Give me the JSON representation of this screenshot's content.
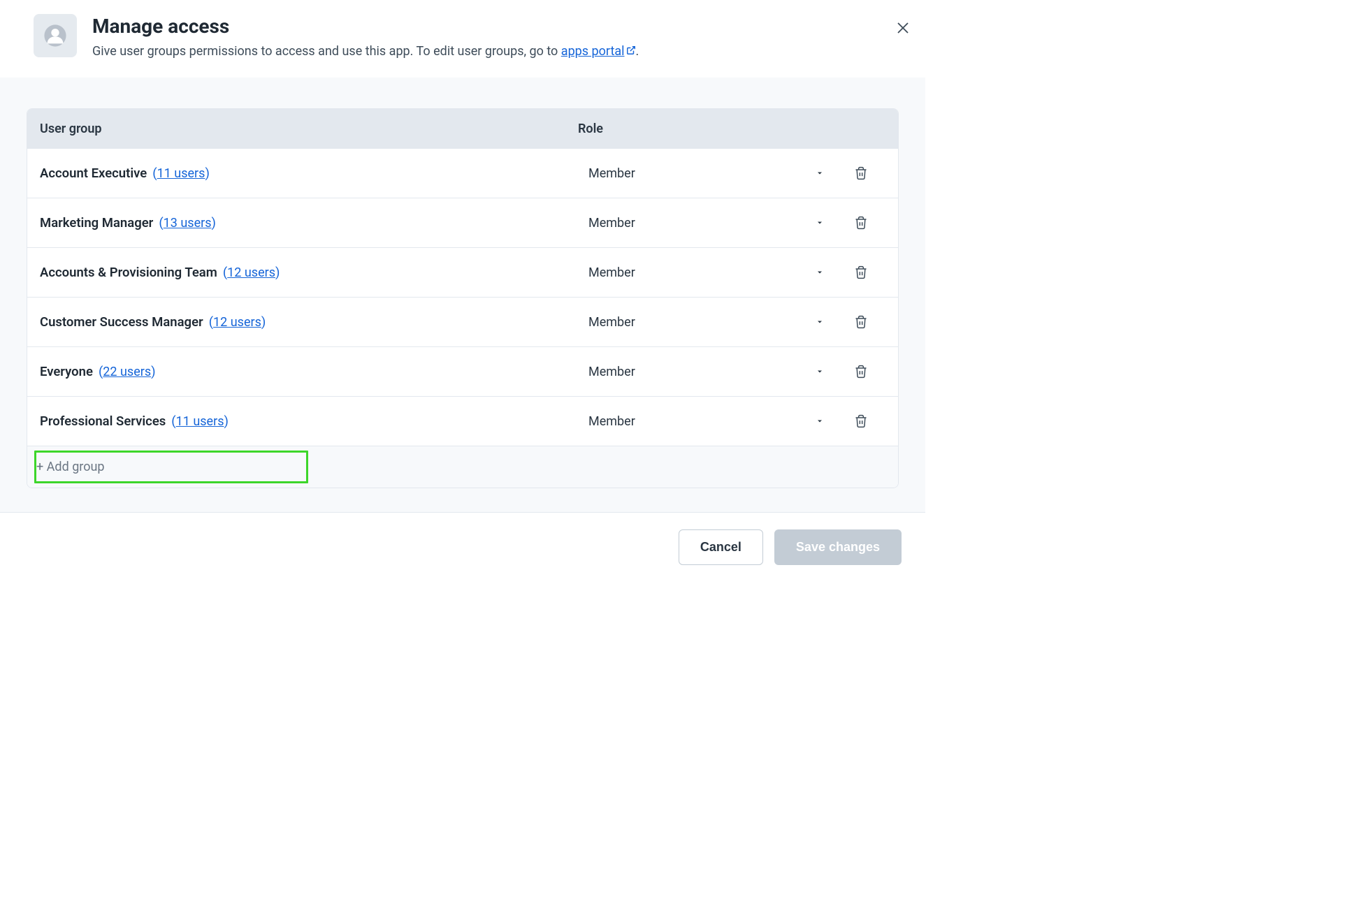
{
  "header": {
    "title": "Manage access",
    "subtitle_prefix": "Give user groups permissions to access and use this app. To edit user groups, go to ",
    "subtitle_link": "apps portal",
    "subtitle_suffix": "."
  },
  "table": {
    "col_group": "User group",
    "col_role": "Role",
    "rows": [
      {
        "name": "Account Executive",
        "users_label": "11 users",
        "role": "Member"
      },
      {
        "name": "Marketing Manager",
        "users_label": "13 users",
        "role": "Member"
      },
      {
        "name": "Accounts & Provisioning Team",
        "users_label": "12 users",
        "role": "Member"
      },
      {
        "name": "Customer Success Manager",
        "users_label": "12 users",
        "role": "Member"
      },
      {
        "name": "Everyone",
        "users_label": "22 users",
        "role": "Member"
      },
      {
        "name": "Professional Services",
        "users_label": "11 users",
        "role": "Member"
      }
    ],
    "add_group_label": "+ Add group"
  },
  "footer": {
    "cancel": "Cancel",
    "save": "Save changes"
  }
}
